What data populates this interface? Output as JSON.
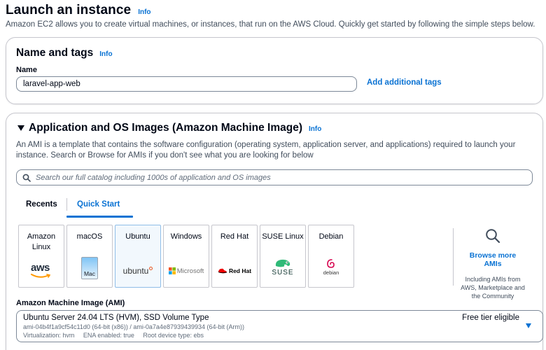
{
  "page": {
    "title": "Launch an instance",
    "info": "Info",
    "description": "Amazon EC2 allows you to create virtual machines, or instances, that run on the AWS Cloud. Quickly get started by following the simple steps below."
  },
  "name_and_tags": {
    "title": "Name and tags",
    "info": "Info",
    "name_label": "Name",
    "name_value": "laravel-app-web",
    "add_tags_label": "Add additional tags"
  },
  "ami_section": {
    "title": "Application and OS Images (Amazon Machine Image)",
    "info": "Info",
    "description": "An AMI is a template that contains the software configuration (operating system, application server, and applications) required to launch your instance. Search or Browse for AMIs if you don't see what you are looking for below",
    "search_placeholder": "Search our full catalog including 1000s of application and OS images",
    "tabs": [
      {
        "label": "Recents",
        "active": false
      },
      {
        "label": "Quick Start",
        "active": true
      }
    ],
    "tiles": [
      {
        "label": "Amazon Linux",
        "logo": "aws",
        "selected": false
      },
      {
        "label": "macOS",
        "logo": "Mac",
        "selected": false
      },
      {
        "label": "Ubuntu",
        "logo": "ubuntu",
        "selected": true
      },
      {
        "label": "Windows",
        "logo": "Microsoft",
        "selected": false
      },
      {
        "label": "Red Hat",
        "logo": "Red Hat",
        "selected": false
      },
      {
        "label": "SUSE Linux",
        "logo": "SUSE",
        "selected": false
      },
      {
        "label": "Debian",
        "logo": "debian",
        "selected": false
      }
    ],
    "browse_more": {
      "link": "Browse more AMIs",
      "subtext": "Including AMIs from AWS, Marketplace and the Community"
    },
    "ami_label": "Amazon Machine Image (AMI)",
    "selected_ami": {
      "name": "Ubuntu Server 24.04 LTS (HVM), SSD Volume Type",
      "ids": "ami-04b4f1a9cf54c11d0 (64-bit (x86)) / ami-0a7a4e87939439934 (64-bit (Arm))",
      "details": "Virtualization: hvm     ENA enabled: true     Root device type: ebs",
      "badge": "Free tier eligible"
    }
  },
  "colors": {
    "link": "#0972d3",
    "text": "#000716",
    "border": "#c6c6cd",
    "aws_orange": "#ff9900",
    "ubuntu_orange": "#e95420",
    "redhat_red": "#ee0000",
    "suse_green": "#30ba78",
    "debian_red": "#d70751"
  }
}
